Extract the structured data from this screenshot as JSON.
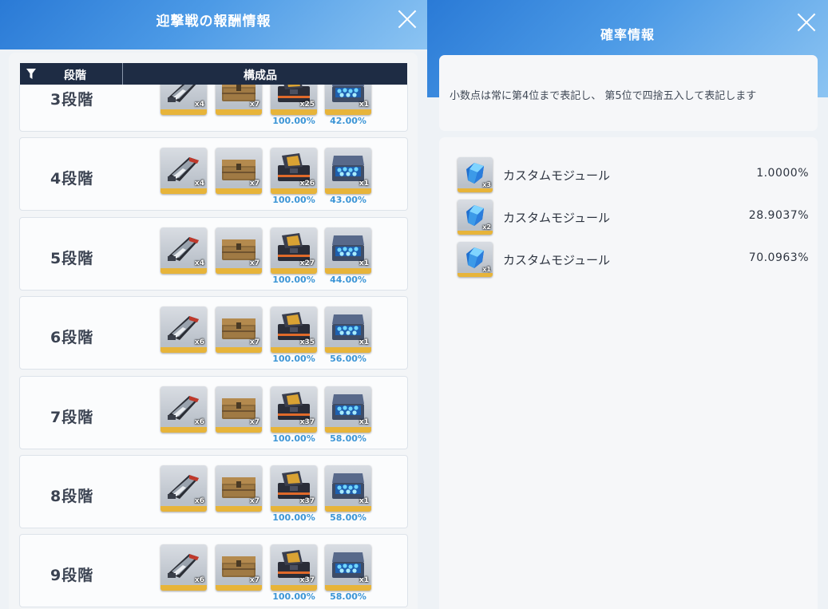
{
  "left": {
    "title": "迎撃戦の報酬情報",
    "table_header": {
      "stage": "段階",
      "items": "構成品"
    },
    "rows": [
      {
        "stage": "3段階",
        "items": [
          {
            "type": "launcher",
            "qty": "x4",
            "rate": ""
          },
          {
            "type": "crate",
            "qty": "x7",
            "rate": ""
          },
          {
            "type": "dark_box",
            "qty": "x25",
            "rate": "100.00%"
          },
          {
            "type": "module_box",
            "qty": "x1",
            "rate": "42.00%"
          }
        ]
      },
      {
        "stage": "4段階",
        "items": [
          {
            "type": "launcher",
            "qty": "x4",
            "rate": ""
          },
          {
            "type": "crate",
            "qty": "x7",
            "rate": ""
          },
          {
            "type": "dark_box",
            "qty": "x26",
            "rate": "100.00%"
          },
          {
            "type": "module_box",
            "qty": "x1",
            "rate": "43.00%"
          }
        ]
      },
      {
        "stage": "5段階",
        "items": [
          {
            "type": "launcher",
            "qty": "x4",
            "rate": ""
          },
          {
            "type": "crate",
            "qty": "x7",
            "rate": ""
          },
          {
            "type": "dark_box",
            "qty": "x27",
            "rate": "100.00%"
          },
          {
            "type": "module_box",
            "qty": "x1",
            "rate": "44.00%"
          }
        ]
      },
      {
        "stage": "6段階",
        "items": [
          {
            "type": "launcher",
            "qty": "x6",
            "rate": ""
          },
          {
            "type": "crate",
            "qty": "x7",
            "rate": ""
          },
          {
            "type": "dark_box",
            "qty": "x35",
            "rate": "100.00%"
          },
          {
            "type": "module_box",
            "qty": "x1",
            "rate": "56.00%"
          }
        ]
      },
      {
        "stage": "7段階",
        "items": [
          {
            "type": "launcher",
            "qty": "x6",
            "rate": ""
          },
          {
            "type": "crate",
            "qty": "x7",
            "rate": ""
          },
          {
            "type": "dark_box",
            "qty": "x37",
            "rate": "100.00%"
          },
          {
            "type": "module_box",
            "qty": "x1",
            "rate": "58.00%"
          }
        ]
      },
      {
        "stage": "8段階",
        "items": [
          {
            "type": "launcher",
            "qty": "x6",
            "rate": ""
          },
          {
            "type": "crate",
            "qty": "x7",
            "rate": ""
          },
          {
            "type": "dark_box",
            "qty": "x37",
            "rate": "100.00%"
          },
          {
            "type": "module_box",
            "qty": "x1",
            "rate": "58.00%"
          }
        ]
      },
      {
        "stage": "9段階",
        "items": [
          {
            "type": "launcher",
            "qty": "x6",
            "rate": ""
          },
          {
            "type": "crate",
            "qty": "x7",
            "rate": ""
          },
          {
            "type": "dark_box",
            "qty": "x37",
            "rate": "100.00%"
          },
          {
            "type": "module_box",
            "qty": "x1",
            "rate": "58.00%"
          }
        ]
      }
    ]
  },
  "right": {
    "title": "確率情報",
    "note": "小数点は常に第4位まで表記し、 第5位で四捨五入して表記します",
    "items": [
      {
        "icon": "crystal-module-icon",
        "qty": "x3",
        "name": "カスタムモジュール",
        "value": "1.0000%"
      },
      {
        "icon": "crystal-module-icon",
        "qty": "x2",
        "name": "カスタムモジュール",
        "value": "28.9037%"
      },
      {
        "icon": "crystal-module-icon",
        "qty": "x1",
        "name": "カスタムモジュール",
        "value": "70.0963%"
      }
    ]
  },
  "colors": {
    "header_blue": "#2a7ad6",
    "table_header": "#1e2c44",
    "rate_blue": "#3b95d6",
    "rarity_gold": "#e7b43a"
  }
}
